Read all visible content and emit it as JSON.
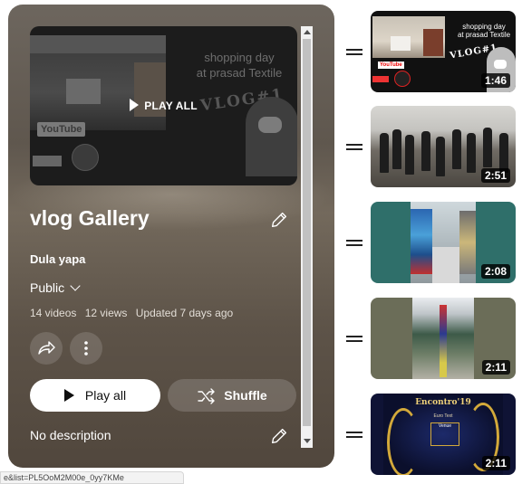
{
  "playlist": {
    "title": "vlog Gallery",
    "owner": "Dula yapa",
    "privacy": "Public",
    "stats": {
      "videos": "14 videos",
      "views": "12 views",
      "updated": "Updated 7 days ago"
    },
    "description": "No description",
    "hero": {
      "overlay_label": "PLAY ALL",
      "thumb_text_line1": "shopping day",
      "thumb_text_line2": "at prasad Textile",
      "thumb_vlog": "VLOG#1",
      "thumb_logo": "YouTube"
    },
    "buttons": {
      "play_all": "Play all",
      "shuffle": "Shuffle"
    }
  },
  "videos": [
    {
      "duration": "1:46",
      "thumb_text_line1": "shopping day",
      "thumb_text_line2": "at prasad Textile",
      "thumb_vlog": "VLOG#1",
      "thumb_logo": "YouTube"
    },
    {
      "duration": "2:51"
    },
    {
      "duration": "2:08"
    },
    {
      "duration": "2:11"
    },
    {
      "duration": "2:11",
      "poster_title": "Encontro'19",
      "poster_sub": "Euro Text",
      "poster_box": "Venue"
    }
  ],
  "status_bar": {
    "url": "e&list=PL5OoM2M00e_0yy7KMe"
  },
  "icons": [
    "play-icon",
    "pencil-icon",
    "chevron-down-icon",
    "share-icon",
    "more-vert-icon",
    "shuffle-icon",
    "drag-handle-icon"
  ],
  "colors": {
    "panel": "#5f574e",
    "play_button_bg": "#ffffff",
    "duration_bg": "#000000"
  }
}
